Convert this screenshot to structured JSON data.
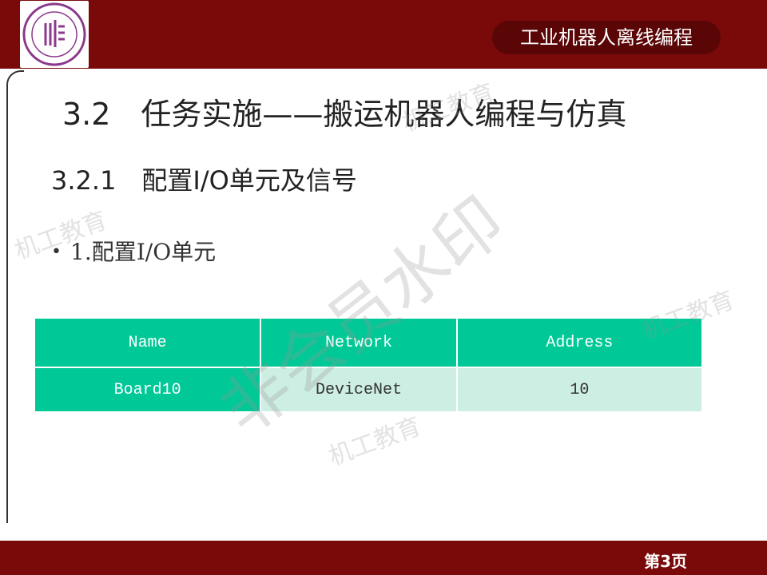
{
  "header": {
    "course_title": "工业机器人离线编程"
  },
  "slide": {
    "heading1": "3.2　任务实施——搬运机器人编程与仿真",
    "heading2": "3.2.1　配置I/O单元及信号",
    "bullet_marker": "•",
    "bullet_text": "1.配置I/O单元"
  },
  "io_table": {
    "headers": [
      "Name",
      "Network",
      "Address"
    ],
    "rows": [
      [
        "Board10",
        "DeviceNet",
        "10"
      ]
    ]
  },
  "footer": {
    "page_label": "第3页"
  },
  "watermarks": {
    "brand": "机工教育",
    "member": "非会员水印"
  },
  "colors": {
    "bar": "#7a0a0a",
    "pill": "#5a0606",
    "table_header": "#00c896",
    "table_cell": "#cdeee2"
  }
}
